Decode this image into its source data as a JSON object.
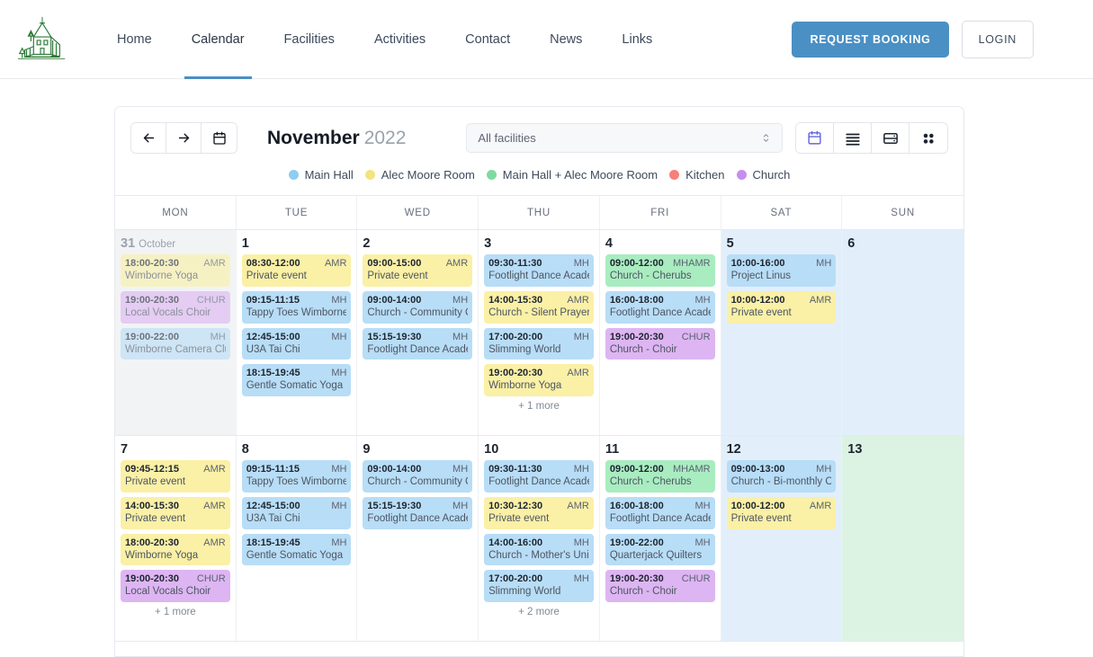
{
  "header": {
    "logo_alt": "village-hall-logo",
    "nav": [
      {
        "label": "Home",
        "active": false
      },
      {
        "label": "Calendar",
        "active": true
      },
      {
        "label": "Facilities",
        "active": false
      },
      {
        "label": "Activities",
        "active": false
      },
      {
        "label": "Contact",
        "active": false
      },
      {
        "label": "News",
        "active": false
      },
      {
        "label": "Links",
        "active": false
      }
    ],
    "request_booking_label": "REQUEST BOOKING",
    "login_label": "LOGIN",
    "accent_color": "#4a90c4"
  },
  "toolbar": {
    "prev_label": "←",
    "next_label": "→",
    "today_icon": "calendar-icon",
    "month": "November",
    "year": "2022",
    "facility_filter": {
      "value": "All facilities",
      "options": [
        "All facilities",
        "Main Hall",
        "Alec Moore Room",
        "Main Hall + Alec Moore Room",
        "Kitchen",
        "Church"
      ]
    },
    "views": [
      {
        "name": "month-view",
        "icon": "calendar-icon",
        "active": true
      },
      {
        "name": "list-view",
        "icon": "list-icon",
        "active": false
      },
      {
        "name": "agenda-view",
        "icon": "rows-icon",
        "active": false
      },
      {
        "name": "grid-view",
        "icon": "grid-icon",
        "active": false
      }
    ]
  },
  "legend": [
    {
      "label": "Main Hall",
      "color": "#8ecdf0"
    },
    {
      "label": "Alec Moore Room",
      "color": "#f5e37e"
    },
    {
      "label": "Main Hall + Alec Moore Room",
      "color": "#7ddba0"
    },
    {
      "label": "Kitchen",
      "color": "#f78079"
    },
    {
      "label": "Church",
      "color": "#c58ef0"
    }
  ],
  "weekdays": [
    "MON",
    "TUE",
    "WED",
    "THU",
    "FRI",
    "SAT",
    "SUN"
  ],
  "weeks": [
    [
      {
        "day": "31",
        "month_label": "October",
        "outside": true,
        "weekend": false,
        "today": false,
        "events": [
          {
            "time": "18:00-20:30",
            "room": "AMR",
            "title": "Wimborne Yoga",
            "cls": "amr"
          },
          {
            "time": "19:00-20:30",
            "room": "CHUR",
            "title": "Local Vocals Choir",
            "cls": "chur"
          },
          {
            "time": "19:00-22:00",
            "room": "MH",
            "title": "Wimborne Camera Club",
            "cls": "mh"
          }
        ],
        "more": ""
      },
      {
        "day": "1",
        "month_label": "",
        "outside": false,
        "weekend": false,
        "today": false,
        "events": [
          {
            "time": "08:30-12:00",
            "room": "AMR",
            "title": "Private event",
            "cls": "amr"
          },
          {
            "time": "09:15-11:15",
            "room": "MH",
            "title": "Tappy Toes Wimborne",
            "cls": "mh"
          },
          {
            "time": "12:45-15:00",
            "room": "MH",
            "title": "U3A Tai Chi",
            "cls": "mh"
          },
          {
            "time": "18:15-19:45",
            "room": "MH",
            "title": "Gentle Somatic Yoga",
            "cls": "mh"
          }
        ],
        "more": ""
      },
      {
        "day": "2",
        "month_label": "",
        "outside": false,
        "weekend": false,
        "today": false,
        "events": [
          {
            "time": "09:00-15:00",
            "room": "AMR",
            "title": "Private event",
            "cls": "amr"
          },
          {
            "time": "09:00-14:00",
            "room": "MH",
            "title": "Church - Community Cafe",
            "cls": "mh"
          },
          {
            "time": "15:15-19:30",
            "room": "MH",
            "title": "Footlight Dance Academy",
            "cls": "mh"
          }
        ],
        "more": ""
      },
      {
        "day": "3",
        "month_label": "",
        "outside": false,
        "weekend": false,
        "today": false,
        "events": [
          {
            "time": "09:30-11:30",
            "room": "MH",
            "title": "Footlight Dance Academy",
            "cls": "mh"
          },
          {
            "time": "14:00-15:30",
            "room": "AMR",
            "title": "Church - Silent Prayer",
            "cls": "amr"
          },
          {
            "time": "17:00-20:00",
            "room": "MH",
            "title": "Slimming World",
            "cls": "mh"
          },
          {
            "time": "19:00-20:30",
            "room": "AMR",
            "title": "Wimborne Yoga",
            "cls": "amr"
          }
        ],
        "more": "+ 1 more"
      },
      {
        "day": "4",
        "month_label": "",
        "outside": false,
        "weekend": false,
        "today": false,
        "events": [
          {
            "time": "09:00-12:00",
            "room": "MHAMR",
            "title": "Church - Cherubs",
            "cls": "mhamr"
          },
          {
            "time": "16:00-18:00",
            "room": "MH",
            "title": "Footlight Dance Academy",
            "cls": "mh"
          },
          {
            "time": "19:00-20:30",
            "room": "CHUR",
            "title": "Church - Choir",
            "cls": "chur"
          }
        ],
        "more": ""
      },
      {
        "day": "5",
        "month_label": "",
        "outside": false,
        "weekend": true,
        "today": false,
        "events": [
          {
            "time": "10:00-16:00",
            "room": "MH",
            "title": "Project Linus",
            "cls": "mh"
          },
          {
            "time": "10:00-12:00",
            "room": "AMR",
            "title": "Private event",
            "cls": "amr"
          }
        ],
        "more": ""
      },
      {
        "day": "6",
        "month_label": "",
        "outside": false,
        "weekend": true,
        "today": false,
        "events": [],
        "more": ""
      }
    ],
    [
      {
        "day": "7",
        "month_label": "",
        "outside": false,
        "weekend": false,
        "today": false,
        "events": [
          {
            "time": "09:45-12:15",
            "room": "AMR",
            "title": "Private event",
            "cls": "amr"
          },
          {
            "time": "14:00-15:30",
            "room": "AMR",
            "title": "Private event",
            "cls": "amr"
          },
          {
            "time": "18:00-20:30",
            "room": "AMR",
            "title": "Wimborne Yoga",
            "cls": "amr"
          },
          {
            "time": "19:00-20:30",
            "room": "CHUR",
            "title": "Local Vocals Choir",
            "cls": "chur"
          }
        ],
        "more": "+ 1 more"
      },
      {
        "day": "8",
        "month_label": "",
        "outside": false,
        "weekend": false,
        "today": false,
        "events": [
          {
            "time": "09:15-11:15",
            "room": "MH",
            "title": "Tappy Toes Wimborne",
            "cls": "mh"
          },
          {
            "time": "12:45-15:00",
            "room": "MH",
            "title": "U3A Tai Chi",
            "cls": "mh"
          },
          {
            "time": "18:15-19:45",
            "room": "MH",
            "title": "Gentle Somatic Yoga",
            "cls": "mh"
          }
        ],
        "more": ""
      },
      {
        "day": "9",
        "month_label": "",
        "outside": false,
        "weekend": false,
        "today": false,
        "events": [
          {
            "time": "09:00-14:00",
            "room": "MH",
            "title": "Church - Community Cafe",
            "cls": "mh"
          },
          {
            "time": "15:15-19:30",
            "room": "MH",
            "title": "Footlight Dance Academy",
            "cls": "mh"
          }
        ],
        "more": ""
      },
      {
        "day": "10",
        "month_label": "",
        "outside": false,
        "weekend": false,
        "today": false,
        "events": [
          {
            "time": "09:30-11:30",
            "room": "MH",
            "title": "Footlight Dance Academy",
            "cls": "mh"
          },
          {
            "time": "10:30-12:30",
            "room": "AMR",
            "title": "Private event",
            "cls": "amr"
          },
          {
            "time": "14:00-16:00",
            "room": "MH",
            "title": "Church - Mother's Union",
            "cls": "mh"
          },
          {
            "time": "17:00-20:00",
            "room": "MH",
            "title": "Slimming World",
            "cls": "mh"
          }
        ],
        "more": "+ 2 more"
      },
      {
        "day": "11",
        "month_label": "",
        "outside": false,
        "weekend": false,
        "today": false,
        "events": [
          {
            "time": "09:00-12:00",
            "room": "MHAMR",
            "title": "Church - Cherubs",
            "cls": "mhamr"
          },
          {
            "time": "16:00-18:00",
            "room": "MH",
            "title": "Footlight Dance Academy",
            "cls": "mh"
          },
          {
            "time": "19:00-22:00",
            "room": "MH",
            "title": "Quarterjack Quilters",
            "cls": "mh"
          },
          {
            "time": "19:00-20:30",
            "room": "CHUR",
            "title": "Church - Choir",
            "cls": "chur"
          }
        ],
        "more": ""
      },
      {
        "day": "12",
        "month_label": "",
        "outside": false,
        "weekend": true,
        "today": false,
        "events": [
          {
            "time": "09:00-13:00",
            "room": "MH",
            "title": "Church - Bi-monthly Coffee",
            "cls": "mh"
          },
          {
            "time": "10:00-12:00",
            "room": "AMR",
            "title": "Private event",
            "cls": "amr"
          }
        ],
        "more": ""
      },
      {
        "day": "13",
        "month_label": "",
        "outside": false,
        "weekend": true,
        "today": true,
        "events": [],
        "more": ""
      }
    ]
  ]
}
